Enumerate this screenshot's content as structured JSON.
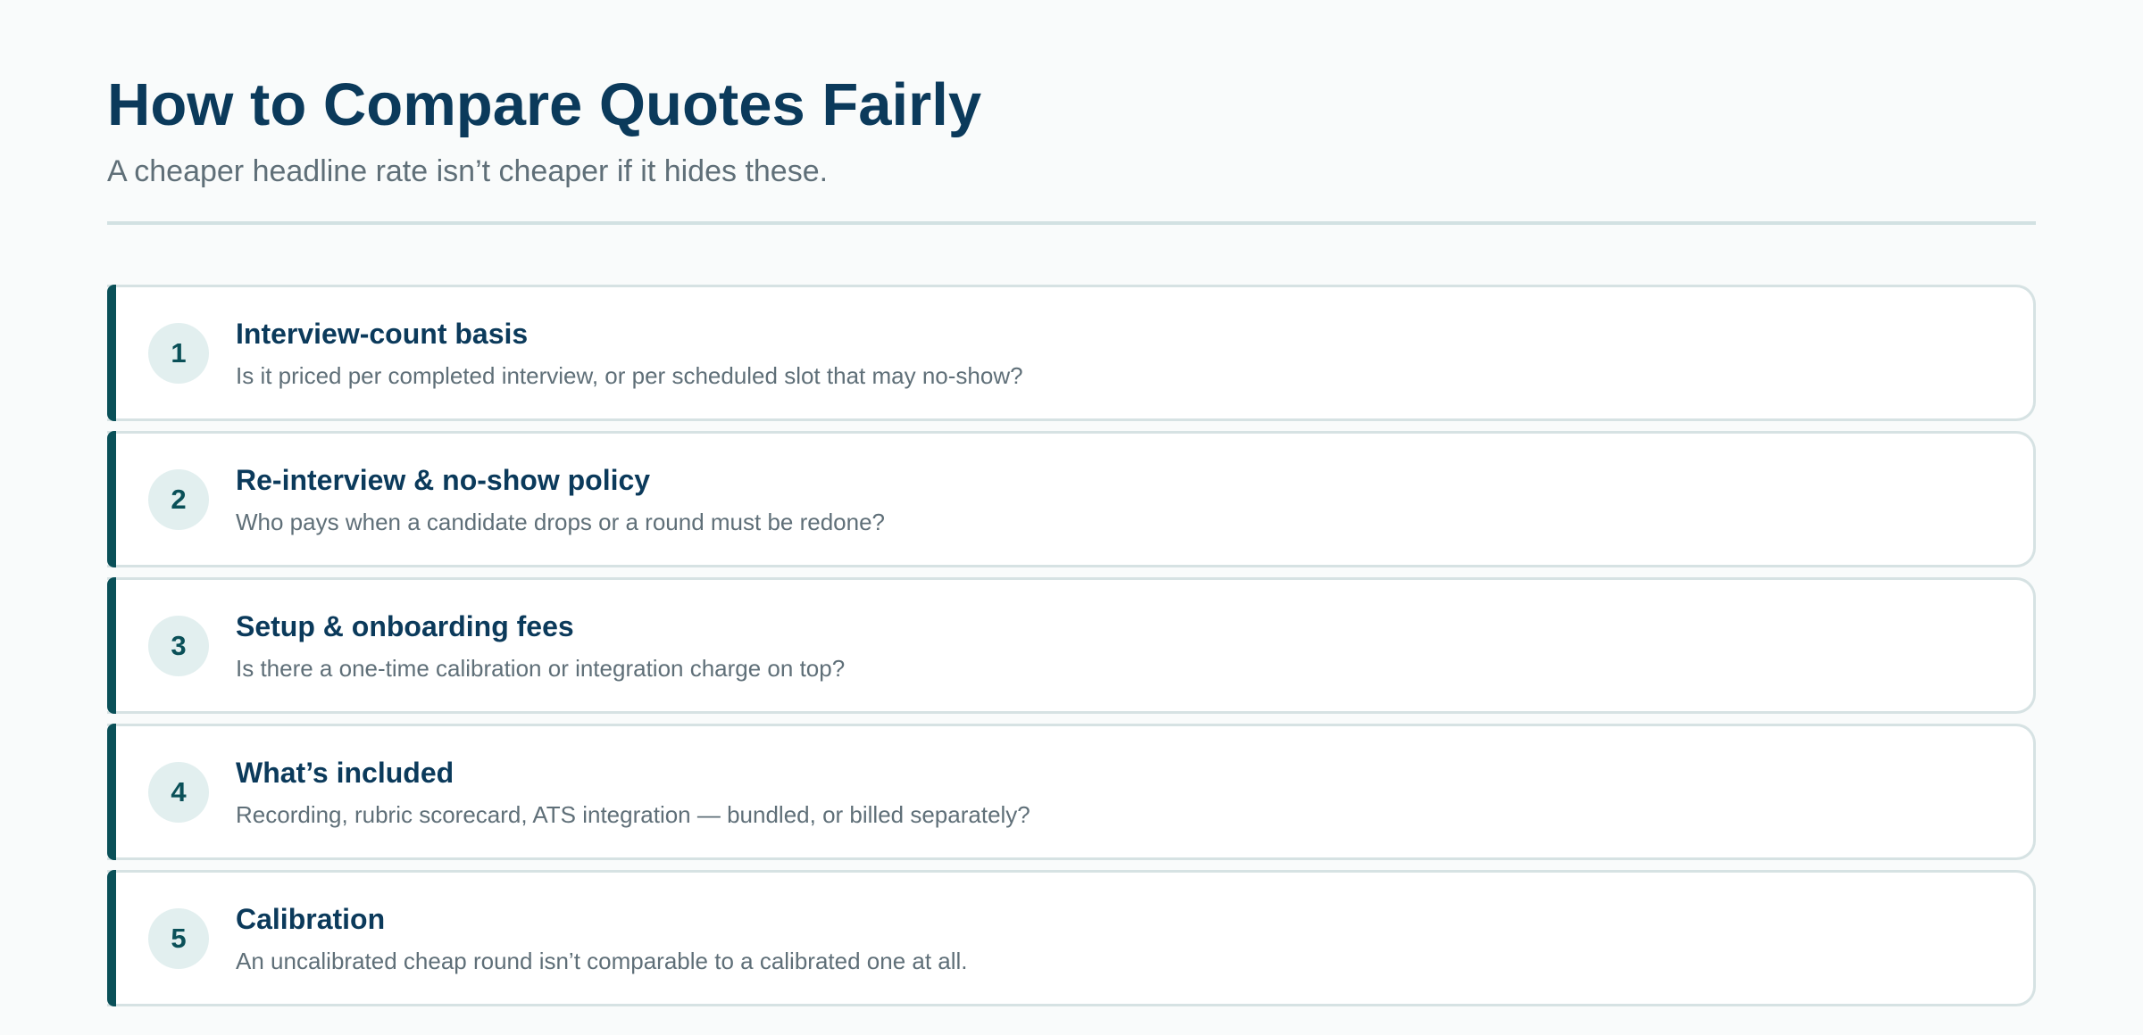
{
  "header": {
    "title": "How to Compare Quotes Fairly",
    "subtitle": "A cheaper headline rate isn’t cheaper if it hides these."
  },
  "items": [
    {
      "number": "1",
      "title": "Interview-count basis",
      "description": "Is it priced per completed interview, or per scheduled slot that may no-show?"
    },
    {
      "number": "2",
      "title": "Re-interview & no-show policy",
      "description": "Who pays when a candidate drops or a round must be redone?"
    },
    {
      "number": "3",
      "title": "Setup & onboarding fees",
      "description": "Is there a one-time calibration or integration charge on top?"
    },
    {
      "number": "4",
      "title": "What’s included",
      "description": "Recording, rubric scorecard, ATS integration — bundled, or billed separately?"
    },
    {
      "number": "5",
      "title": "Calibration",
      "description": "An uncalibrated cheap round isn’t comparable to a calibrated one at all."
    }
  ],
  "colors": {
    "background": "#f9fbfb",
    "title": "#0b3a5b",
    "muted_text": "#5f6f78",
    "accent": "#0a5058",
    "badge_background": "#e2efef",
    "border": "#d6e2e3"
  }
}
